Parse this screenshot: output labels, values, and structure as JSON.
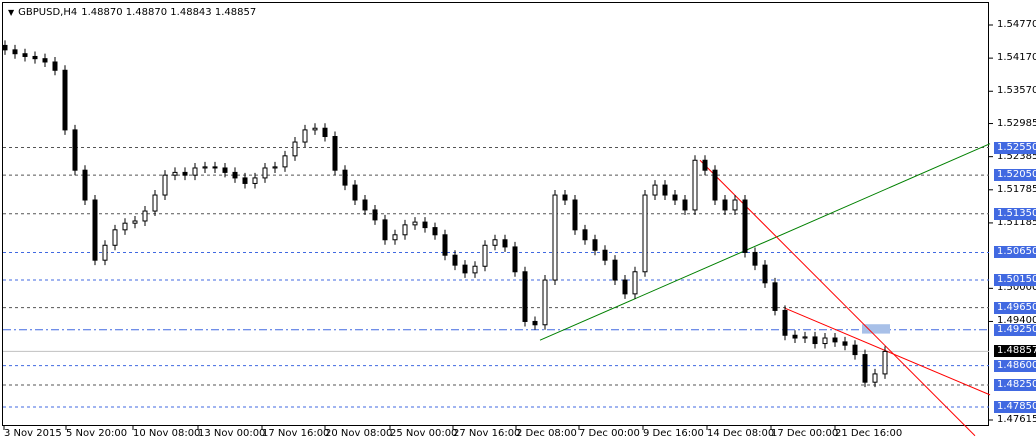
{
  "window": {
    "symbol": "GBPUSD,H4",
    "ohlc": "1.48870 1.48870 1.48843 1.48857"
  },
  "chart_data": {
    "type": "candlestick",
    "symbol": "GBPUSD",
    "timeframe": "H4",
    "ylim": [
      1.47615,
      1.5477
    ],
    "y_ticks": [
      "1.54770",
      "1.54170",
      "1.53570",
      "1.52985",
      "1.52385",
      "1.51785",
      "1.51185",
      "1.50000",
      "1.49400",
      "1.47615"
    ],
    "x_ticks": [
      "3 Nov 2015",
      "5 Nov 20:00",
      "10 Nov 08:00",
      "13 Nov 00:00",
      "17 Nov 16:00",
      "20 Nov 08:00",
      "25 Nov 00:00",
      "27 Nov 16:00",
      "2 Dec 08:00",
      "7 Dec 00:00",
      "9 Dec 16:00",
      "14 Dec 08:00",
      "17 Dec 00:00",
      "21 Dec 16:00"
    ],
    "closes": [
      1.5432,
      1.5425,
      1.542,
      1.5416,
      1.541,
      1.5395,
      1.5287,
      1.5214,
      1.516,
      1.5051,
      1.5078,
      1.5106,
      1.5118,
      1.5122,
      1.514,
      1.5169,
      1.5205,
      1.521,
      1.5205,
      1.5218,
      1.522,
      1.5218,
      1.521,
      1.52,
      1.519,
      1.52,
      1.5218,
      1.522,
      1.524,
      1.5265,
      1.5287,
      1.529,
      1.5275,
      1.5214,
      1.5187,
      1.516,
      1.5142,
      1.5124,
      1.5088,
      1.5097,
      1.5115,
      1.512,
      1.511,
      1.5097,
      1.506,
      1.5042,
      1.5028,
      1.504,
      1.5078,
      1.5088,
      1.5075,
      1.503,
      1.494,
      1.4934,
      1.5015,
      1.5169,
      1.516,
      1.5106,
      1.5088,
      1.5069,
      1.5051,
      1.5015,
      1.499,
      1.503,
      1.5169,
      1.5187,
      1.5169,
      1.516,
      1.5142,
      1.5232,
      1.5214,
      1.516,
      1.5142,
      1.516,
      1.5065,
      1.5042,
      1.501,
      1.496,
      1.4915,
      1.491,
      1.4912,
      1.49,
      1.491,
      1.4903,
      1.4897,
      1.488,
      1.483,
      1.4845,
      1.48857
    ],
    "levels": [
      {
        "price": "1.52550",
        "color": "#555555",
        "style": "dash"
      },
      {
        "price": "1.52050",
        "color": "#555555",
        "style": "dash"
      },
      {
        "price": "1.51350",
        "color": "#555555",
        "style": "dash"
      },
      {
        "price": "1.50650",
        "color": "#4169e1",
        "style": "dash"
      },
      {
        "price": "1.50150",
        "color": "#4169e1",
        "style": "dash"
      },
      {
        "price": "1.49650",
        "color": "#555555",
        "style": "dash"
      },
      {
        "price": "1.49250",
        "color": "#4169e1",
        "style": "dashdot"
      },
      {
        "price": "1.48600",
        "color": "#4169e1",
        "style": "dash"
      },
      {
        "price": "1.48250",
        "color": "#555555",
        "style": "dash"
      },
      {
        "price": "1.47850",
        "color": "#4169e1",
        "style": "dash"
      }
    ],
    "bid": {
      "price": "1.48857",
      "color": "#c0c0c0"
    },
    "trendlines": [
      {
        "from": [
          53.5,
          1.4906
        ],
        "to": [
          98.5,
          1.5262
        ],
        "color": "#008000"
      },
      {
        "from": [
          69.5,
          1.5232
        ],
        "to": [
          97,
          1.4733
        ],
        "color": "#ff0000"
      },
      {
        "from": [
          78,
          1.4964
        ],
        "to": [
          98.5,
          1.4807
        ],
        "color": "#ff0000"
      }
    ],
    "colors": {
      "bull": "#ffffff",
      "bear": "#000000",
      "tag": "#4169e1"
    }
  }
}
